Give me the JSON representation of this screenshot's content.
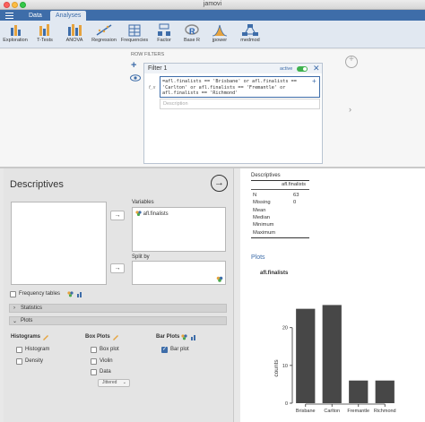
{
  "window": {
    "title": "jamovi"
  },
  "tabs": [
    {
      "label": "Data"
    },
    {
      "label": "Analyses"
    }
  ],
  "toolbar": {
    "items": [
      {
        "label": "Exploration",
        "icon": "exploration-icon"
      },
      {
        "label": "T-Tests",
        "icon": "ttests-icon"
      },
      {
        "label": "ANOVA",
        "icon": "anova-icon"
      },
      {
        "label": "Regression",
        "icon": "regression-icon"
      },
      {
        "label": "Frequencies",
        "icon": "frequencies-icon"
      },
      {
        "label": "Factor",
        "icon": "factor-icon"
      },
      {
        "label": "Base R",
        "icon": "base-r-icon"
      },
      {
        "label": "jpower",
        "icon": "jpower-icon"
      },
      {
        "label": "medmod",
        "icon": "medmod-icon"
      }
    ]
  },
  "filters": {
    "section_label": "ROW FILTERS",
    "filter_title": "Filter 1",
    "active_label": "active",
    "expression": "=afl.finalists == 'Brisbane' or afl.finalists ==\n'Carlton' or afl.finalists == 'Fremantle' or\nafl.finalists == 'Richmond'",
    "fx_label": "f_x",
    "description_placeholder": "Description"
  },
  "options": {
    "title": "Descriptives",
    "variables_label": "Variables",
    "variable_item": "afl.finalists",
    "split_by_label": "Split by",
    "frequency_tables_label": "Frequency tables",
    "statistics_section": "Statistics",
    "plots_section": "Plots",
    "histograms": {
      "title": "Histograms",
      "histogram": "Histogram",
      "density": "Density"
    },
    "box_plots": {
      "title": "Box Plots",
      "box_plot": "Box plot",
      "violin": "Violin",
      "data": "Data",
      "data_mode": "Jittered"
    },
    "bar_plots": {
      "title": "Bar Plots",
      "bar_plot": "Bar plot"
    }
  },
  "results": {
    "title": "Descriptives",
    "table": {
      "column": "afl.finalists",
      "rows": [
        {
          "label": "N",
          "value": "63"
        },
        {
          "label": "Missing",
          "value": "0"
        },
        {
          "label": "Mean",
          "value": ""
        },
        {
          "label": "Median",
          "value": ""
        },
        {
          "label": "Minimum",
          "value": ""
        },
        {
          "label": "Maximum",
          "value": ""
        }
      ]
    },
    "plots_title": "Plots",
    "plot_title": "afl.finalists"
  },
  "chart_data": {
    "type": "bar",
    "title": "afl.finalists",
    "categories": [
      "Brisbane",
      "Carlton",
      "Fremantle",
      "Richmond"
    ],
    "values": [
      25,
      26,
      6,
      6
    ],
    "ylabel": "counts",
    "xlabel": "",
    "yticks": [
      0,
      10,
      20
    ],
    "ylim": [
      0,
      28
    ],
    "grid": false,
    "bar_color": "#474747"
  },
  "colors": {
    "accent": "#3e6da9",
    "active": "#3eb24e"
  }
}
